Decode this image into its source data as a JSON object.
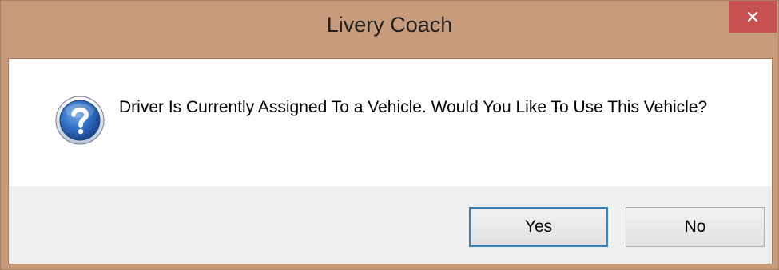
{
  "window": {
    "title": "Livery Coach",
    "close_icon": "close-icon"
  },
  "message": {
    "icon": "question-icon",
    "text": "Driver Is Currently Assigned To a Vehicle.   Would You Like To Use This Vehicle?"
  },
  "buttons": {
    "yes_label": "Yes",
    "no_label": "No",
    "default": "yes"
  },
  "colors": {
    "titlebar": "#c89b7b",
    "close_button": "#c75050",
    "button_area": "#f0f0f0",
    "default_button_border": "#3c7fb1"
  }
}
